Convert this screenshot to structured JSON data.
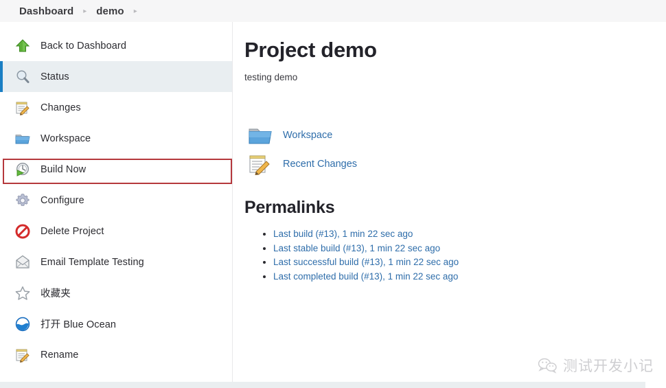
{
  "breadcrumb": {
    "items": [
      "Dashboard",
      "demo"
    ],
    "separator": "▸"
  },
  "sidebar": {
    "items": [
      {
        "label": "Back to Dashboard",
        "icon": "green-up-arrow-icon",
        "state": "normal"
      },
      {
        "label": "Status",
        "icon": "magnifier-icon",
        "state": "active"
      },
      {
        "label": "Changes",
        "icon": "notepad-pencil-icon",
        "state": "normal"
      },
      {
        "label": "Workspace",
        "icon": "folder-icon",
        "state": "normal"
      },
      {
        "label": "Build Now",
        "icon": "clock-play-icon",
        "state": "highlighted"
      },
      {
        "label": "Configure",
        "icon": "gear-icon",
        "state": "normal"
      },
      {
        "label": "Delete Project",
        "icon": "no-entry-icon",
        "state": "normal"
      },
      {
        "label": "Email Template Testing",
        "icon": "envelope-icon",
        "state": "normal"
      },
      {
        "label": "收藏夹",
        "icon": "star-outline-icon",
        "state": "normal"
      },
      {
        "label": "打开 Blue Ocean",
        "icon": "blue-ocean-icon",
        "state": "normal"
      },
      {
        "label": "Rename",
        "icon": "notepad-pencil-icon",
        "state": "normal"
      }
    ],
    "annotation_color": "#b5383c",
    "active_accent_color": "#1b7fc4",
    "active_background_color": "#e9eef1"
  },
  "main": {
    "title": "Project demo",
    "description": "testing demo",
    "links": [
      {
        "label": "Workspace",
        "icon": "folder-icon"
      },
      {
        "label": "Recent Changes",
        "icon": "notepad-pencil-icon"
      }
    ],
    "permalinks_heading": "Permalinks",
    "permalinks": [
      "Last build (#13), 1 min 22 sec ago",
      "Last stable build (#13), 1 min 22 sec ago",
      "Last successful build (#13), 1 min 22 sec ago",
      "Last completed build (#13), 1 min 22 sec ago"
    ],
    "link_color": "#2e6daa"
  },
  "watermark": {
    "text": "测试开发小记",
    "icon": "wechat-icon"
  }
}
